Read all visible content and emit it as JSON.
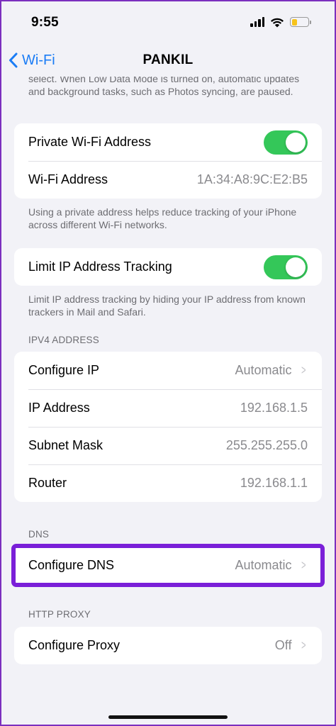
{
  "status_bar": {
    "time": "9:55",
    "battery_level": 0.35,
    "battery_color": "#f7c31b"
  },
  "nav": {
    "back_label": "Wi-Fi",
    "title": "PANKIL"
  },
  "low_data_footnote": "select. When Low Data Mode is turned on, automatic updates and background tasks, such as Photos syncing, are paused.",
  "private_group": {
    "private_address_label": "Private Wi-Fi Address",
    "private_address_on": true,
    "wifi_address_label": "Wi-Fi Address",
    "wifi_address_value": "1A:34:A8:9C:E2:B5",
    "footnote": "Using a private address helps reduce tracking of your iPhone across different Wi-Fi networks."
  },
  "limit_group": {
    "label": "Limit IP Address Tracking",
    "on": true,
    "footnote": "Limit IP address tracking by hiding your IP address from known trackers in Mail and Safari."
  },
  "ipv4": {
    "header": "IPV4 ADDRESS",
    "rows": [
      {
        "label": "Configure IP",
        "value": "Automatic"
      },
      {
        "label": "IP Address",
        "value": "192.168.1.5"
      },
      {
        "label": "Subnet Mask",
        "value": "255.255.255.0"
      },
      {
        "label": "Router",
        "value": "192.168.1.1"
      }
    ]
  },
  "dns": {
    "header": "DNS",
    "label": "Configure DNS",
    "value": "Automatic"
  },
  "proxy": {
    "header": "HTTP PROXY",
    "label": "Configure Proxy",
    "value": "Off"
  },
  "colors": {
    "accent": "#1a7cf5",
    "toggle_on": "#34c759",
    "highlight": "#7a1fd8"
  }
}
